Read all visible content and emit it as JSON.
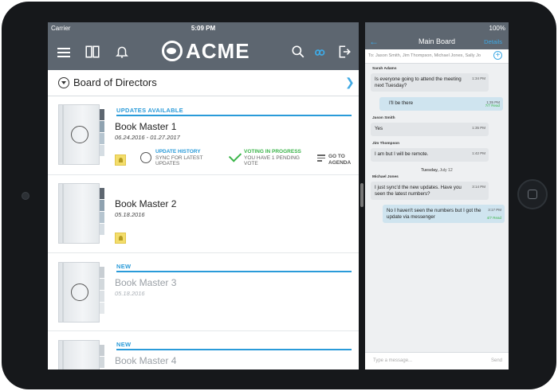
{
  "status": {
    "carrier": "Carrier",
    "time": "5:09 PM",
    "battery": "100%"
  },
  "brand": {
    "name": "ACME",
    "primary": "#5d6670",
    "accent": "#2a9bd9",
    "green": "#3bb54a"
  },
  "board": {
    "title": "Board of Directors"
  },
  "books": [
    {
      "section": "UPDATES AVAILABLE",
      "title": "Book Master 1",
      "date": "06.24.2016 - 01.27.2017",
      "update_history": {
        "heading": "UPDATE HISTORY",
        "sub": "SYNC FOR LATEST UPDATES"
      },
      "voting": {
        "heading": "VOTING IN PROGRESS",
        "sub": "YOU HAVE 1 PENDING VOTE"
      },
      "agenda": "GO TO AGENDA"
    },
    {
      "section": "",
      "title": "Book Master 2",
      "date": "05.18.2016"
    },
    {
      "section": "NEW",
      "title": "Book Master 3",
      "date": "05.18.2016"
    },
    {
      "section": "NEW",
      "title": "Book Master 4"
    }
  ],
  "chat": {
    "title": "Main Board",
    "details": "Details",
    "to": "To: Jason Smith, Jim Thompson, Michael Jones, Sally Jo",
    "messages": [
      {
        "sender": "Sarah Adams",
        "text": "Is everyone going to attend the meeting next Tuesday?",
        "time": "1:34 PM"
      },
      {
        "sender": "",
        "text": "I'll be there",
        "time": "1:35 PM",
        "read": "7/7 Read"
      },
      {
        "sender": "Jason Smith",
        "text": "Yes",
        "time": "1:35 PM"
      },
      {
        "sender": "Jim Thompson",
        "text": "I am but I will be remote.",
        "time": "1:42 PM"
      },
      {
        "sender": "Michael Jones",
        "text": "I just sync'd the new updates. Have you seen the latest numbers?",
        "time": "3:14 PM"
      },
      {
        "sender": "",
        "text": "No I haven't seen the numbers but I got the update via messenger",
        "time": "3:17 PM",
        "read": "4/7 Read"
      }
    ],
    "day_separator": {
      "day": "Tuesday,",
      "date": "July 12"
    },
    "composer": {
      "placeholder": "Type a message...",
      "send": "Send"
    }
  }
}
